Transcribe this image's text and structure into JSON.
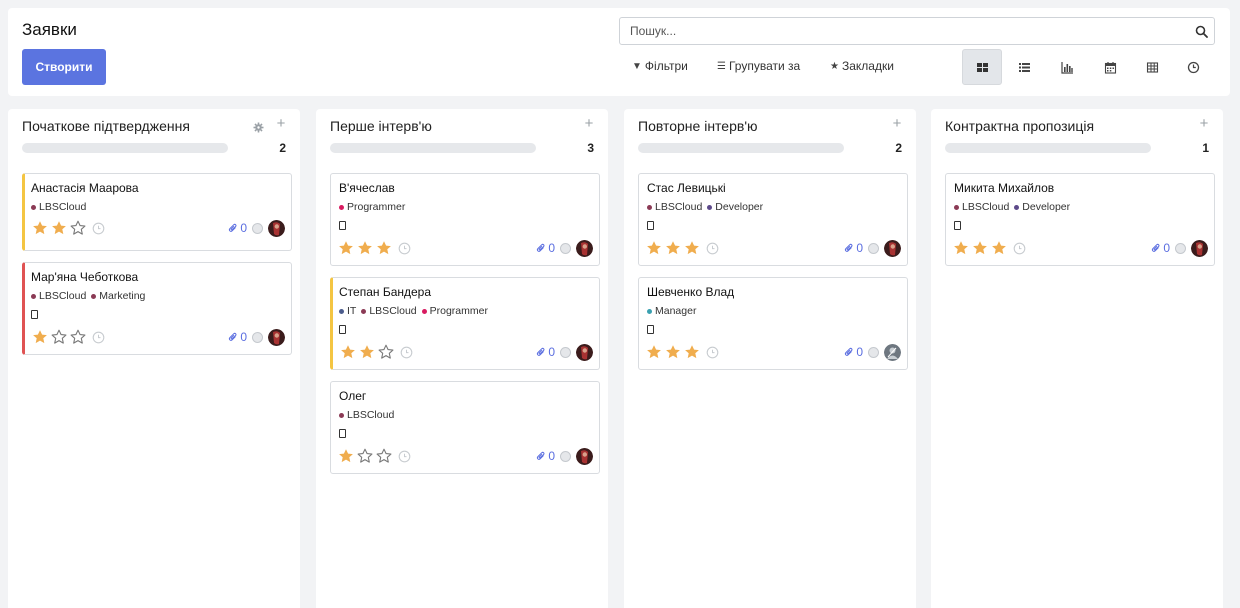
{
  "page": {
    "title": "Заявки"
  },
  "toolbar": {
    "create_label": "Створити",
    "search_placeholder": "Пошук...",
    "filters_label": "Фільтри",
    "group_label": "Групувати за",
    "favorites_label": "Закладки",
    "views": [
      "kanban-icon",
      "list-icon",
      "graph-icon",
      "calendar-icon",
      "pivot-icon",
      "activity-icon"
    ],
    "active_view": "kanban"
  },
  "colors": {
    "primary": "#5b74e0",
    "star_filled": "#f0ad4e",
    "star_empty": "#777777",
    "border_yellow": "#f4c542",
    "border_red": "#e05353",
    "tag_lbscloud": "#8b3a55",
    "tag_marketing": "#8b3a55",
    "tag_programmer": "#d81b60",
    "tag_developer": "#5d4a8a",
    "tag_it": "#4c5c8c",
    "tag_manager": "#3aa0b0"
  },
  "columns": [
    {
      "title": "Початкове підтвердження",
      "count": "2",
      "has_gear": true,
      "cards": [
        {
          "name": "Анастасія Маарова",
          "tags": [
            {
              "label": "LBSCloud",
              "color": "#8b3a55"
            }
          ],
          "has_phone": false,
          "stars": 2,
          "attachments": "0",
          "border": "yellow",
          "avatar": "dark"
        },
        {
          "name": "Мар'яна Чеботкова",
          "tags": [
            {
              "label": "LBSCloud",
              "color": "#8b3a55"
            },
            {
              "label": "Marketing",
              "color": "#8b3a55"
            }
          ],
          "has_phone": true,
          "stars": 1,
          "attachments": "0",
          "border": "red",
          "avatar": "dark"
        }
      ]
    },
    {
      "title": "Перше інтерв'ю",
      "count": "3",
      "has_gear": false,
      "cards": [
        {
          "name": "В'ячеслав",
          "tags": [
            {
              "label": "Programmer",
              "color": "#d81b60"
            }
          ],
          "has_phone": true,
          "stars": 3,
          "attachments": "0",
          "border": "none",
          "avatar": "dark"
        },
        {
          "name": "Степан Бандера",
          "tags": [
            {
              "label": "IT",
              "color": "#4c5c8c"
            },
            {
              "label": "LBSCloud",
              "color": "#8b3a55"
            },
            {
              "label": "Programmer",
              "color": "#d81b60"
            }
          ],
          "has_phone": true,
          "stars": 2,
          "attachments": "0",
          "border": "yellow",
          "avatar": "dark"
        },
        {
          "name": "Олег",
          "tags": [
            {
              "label": "LBSCloud",
              "color": "#8b3a55"
            }
          ],
          "has_phone": true,
          "stars": 1,
          "attachments": "0",
          "border": "none",
          "avatar": "dark"
        }
      ]
    },
    {
      "title": "Повторне інтерв'ю",
      "count": "2",
      "has_gear": false,
      "cards": [
        {
          "name": "Стас Левицькі",
          "tags": [
            {
              "label": "LBSCloud",
              "color": "#8b3a55"
            },
            {
              "label": "Developer",
              "color": "#5d4a8a"
            }
          ],
          "has_phone": true,
          "stars": 3,
          "attachments": "0",
          "border": "none",
          "avatar": "dark"
        },
        {
          "name": "Шевченко Влад",
          "tags": [
            {
              "label": "Manager",
              "color": "#3aa0b0"
            }
          ],
          "has_phone": true,
          "stars": 3,
          "attachments": "0",
          "border": "none",
          "avatar": "gray"
        }
      ]
    },
    {
      "title": "Контрактна пропозиція",
      "count": "1",
      "has_gear": false,
      "cards": [
        {
          "name": "Микита Михайлов",
          "tags": [
            {
              "label": "LBSCloud",
              "color": "#8b3a55"
            },
            {
              "label": "Developer",
              "color": "#5d4a8a"
            }
          ],
          "has_phone": true,
          "stars": 3,
          "attachments": "0",
          "border": "none",
          "avatar": "dark"
        }
      ]
    }
  ]
}
